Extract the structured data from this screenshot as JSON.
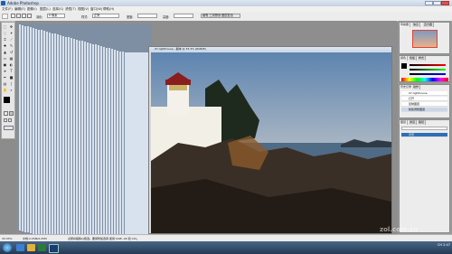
{
  "window": {
    "title": "Adobe Photoshop"
  },
  "menu": [
    "文件(F)",
    "编辑(E)",
    "图像(I)",
    "图层(L)",
    "选择(S)",
    "滤镜(T)",
    "视图(V)",
    "窗口(W)",
    "帮助(H)"
  ],
  "options": {
    "feather_label": "羽化:",
    "feather_value": "0 像素",
    "style_label": "样式:",
    "style_value": "正常",
    "width_label": "宽度:",
    "height_label": "高度:",
    "panel_tabs": "画笔 工具预设 图层复合"
  },
  "document": {
    "title": "07-lighthouse - 副本 @ 33.3% (RGB/8)"
  },
  "panels": {
    "navigator_tabs": [
      "导航器",
      "信息",
      "直方图"
    ],
    "color_tabs": [
      "颜色",
      "色板",
      "样式"
    ],
    "history_tabs": [
      "历史记录",
      "动作"
    ],
    "history_items": [
      "07-lighthouse",
      "打开",
      "复制图层",
      "新建调整图层"
    ],
    "layers_tabs": [
      "图层",
      "通道",
      "路径"
    ],
    "layers_items": [
      "背景"
    ]
  },
  "status": {
    "zoom": "33.33%",
    "doc": "文档:2.25M/2.25M",
    "hint": "点按并拖移以框选。要用附加选项,使用 Shift, Alt 和 Ctrl。"
  },
  "taskbar": {
    "lang": "CH",
    "time": "2:47"
  },
  "watermark": "zol.com.cn",
  "colors": {
    "accent": "#2f6fb5",
    "sky_top": "#5d84b0",
    "sky_horizon": "#f0b88a"
  }
}
